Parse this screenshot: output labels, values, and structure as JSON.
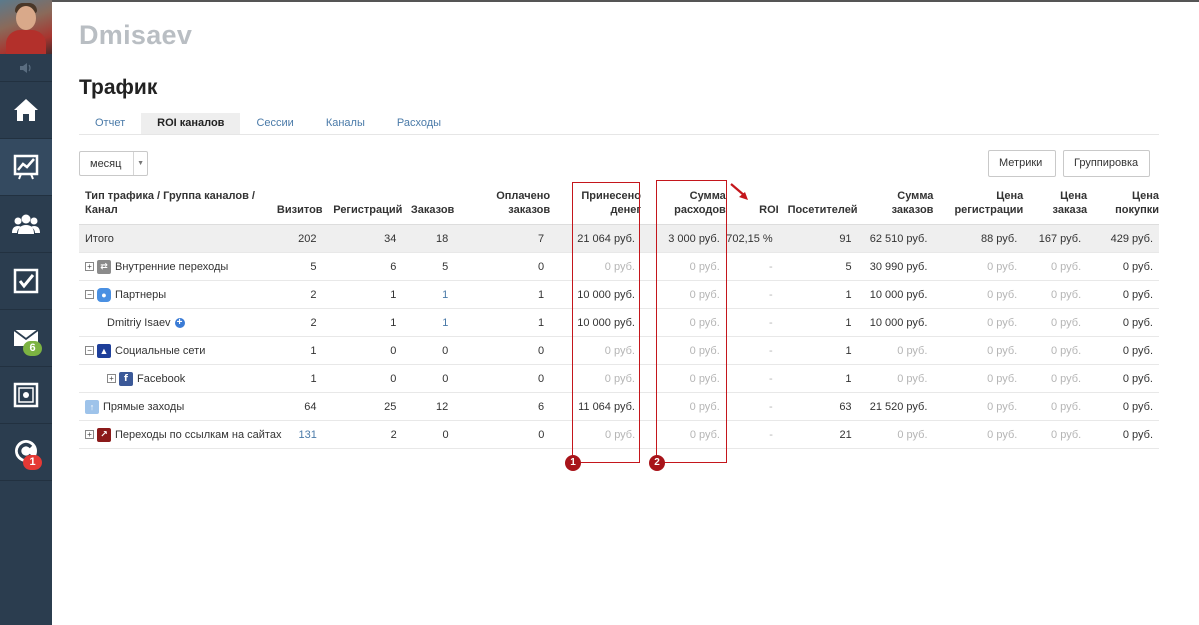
{
  "sidebar": {
    "badges": {
      "mail": "6",
      "crm": "1"
    }
  },
  "site_title": "Dmisaev",
  "page_title": "Трафик",
  "tabs": [
    "Отчет",
    "ROI каналов",
    "Сессии",
    "Каналы",
    "Расходы"
  ],
  "active_tab": 1,
  "period_select": {
    "value": "месяц"
  },
  "buttons": {
    "metrics": "Метрики",
    "grouping": "Группировка"
  },
  "table": {
    "headers": [
      "Тип трафика / Группа каналов / Канал",
      "Визитов",
      "Регистраций",
      "Заказов",
      "Оплачено заказов",
      "Принесено денег",
      "Сумма расходов",
      "ROI",
      "Посетителей",
      "Сумма заказов",
      "Цена регистрации",
      "Цена заказа",
      "Цена покупки"
    ],
    "total": [
      "Итого",
      "202",
      "34",
      "18",
      "7",
      "21 064 руб.",
      "3 000 руб.",
      "702,15 %",
      "91",
      "62 510 руб.",
      "88 руб.",
      "167 руб.",
      "429 руб."
    ],
    "rows": [
      {
        "toggle": "+",
        "icon": "transfer-icon",
        "indent": 0,
        "cells": [
          "Внутренние переходы",
          "5",
          "6",
          "5",
          "0",
          "0 руб.",
          "0 руб.",
          "-",
          "5",
          "30 990 руб.",
          "0 руб.",
          "0 руб.",
          "0 руб."
        ]
      },
      {
        "toggle": "−",
        "icon": "chat-icon",
        "indent": 0,
        "cells": [
          "Партнеры",
          "2",
          "1",
          "1",
          "1",
          "10 000 руб.",
          "0 руб.",
          "-",
          "1",
          "10 000 руб.",
          "0 руб.",
          "0 руб.",
          "0 руб."
        ]
      },
      {
        "toggle": "",
        "icon": "",
        "indent": 1,
        "cells": [
          "Dmitriy Isaev",
          "2",
          "1",
          "1",
          "1",
          "10 000 руб.",
          "0 руб.",
          "-",
          "1",
          "10 000 руб.",
          "0 руб.",
          "0 руб.",
          "0 руб."
        ]
      },
      {
        "toggle": "−",
        "icon": "person-icon",
        "indent": 0,
        "cells": [
          "Социальные сети",
          "1",
          "0",
          "0",
          "0",
          "0 руб.",
          "0 руб.",
          "-",
          "1",
          "0 руб.",
          "0 руб.",
          "0 руб.",
          "0 руб."
        ]
      },
      {
        "toggle": "+",
        "icon": "facebook-icon",
        "indent": 1,
        "cells": [
          "Facebook",
          "1",
          "0",
          "0",
          "0",
          "0 руб.",
          "0 руб.",
          "-",
          "1",
          "0 руб.",
          "0 руб.",
          "0 руб.",
          "0 руб."
        ]
      },
      {
        "toggle": "",
        "icon": "arrow-up-icon",
        "indent": 0,
        "cells": [
          "Прямые заходы",
          "64",
          "25",
          "12",
          "6",
          "11 064 руб.",
          "0 руб.",
          "-",
          "63",
          "21 520 руб.",
          "0 руб.",
          "0 руб.",
          "0 руб."
        ]
      },
      {
        "toggle": "+",
        "icon": "external-link-icon",
        "indent": 0,
        "cells": [
          "Переходы по ссылкам на сайтах",
          "131",
          "2",
          "0",
          "0",
          "0 руб.",
          "0 руб.",
          "-",
          "21",
          "0 руб.",
          "0 руб.",
          "0 руб.",
          "0 руб."
        ]
      }
    ]
  },
  "annotations": [
    "1",
    "2"
  ],
  "colors": {
    "sidebar": "#2b3d4f",
    "link": "#4a7aa8",
    "annotation": "#c4161c"
  }
}
